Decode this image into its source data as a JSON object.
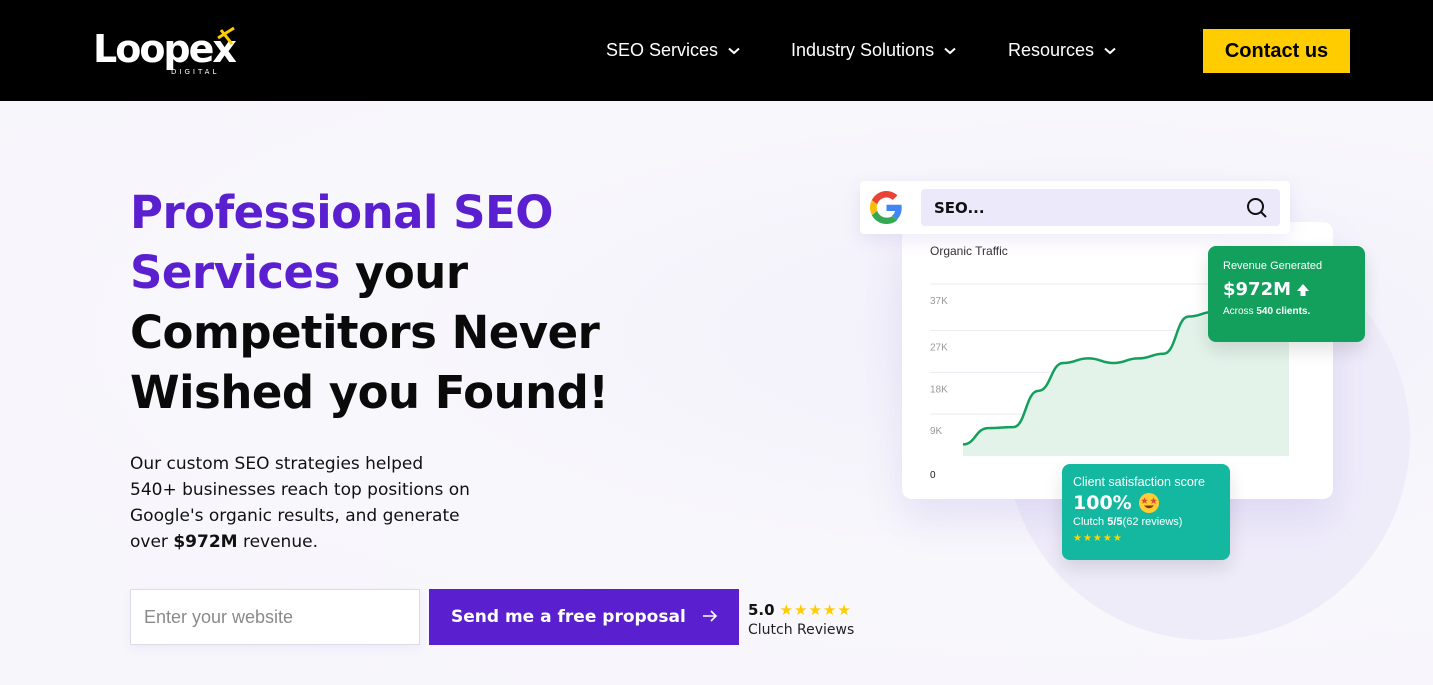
{
  "nav": {
    "logo_text": "Loopex",
    "logo_sub": "DIGITAL",
    "items": [
      {
        "label": "SEO Services"
      },
      {
        "label": "Industry Solutions"
      },
      {
        "label": "Resources"
      }
    ],
    "contact_label": "Contact us"
  },
  "hero": {
    "headline_purple": "Professional SEO Services",
    "headline_black_1": " your",
    "headline_black_2": "Competitors Never Wished you Found!",
    "sub_text": "Our custom SEO strategies helped 540+ businesses reach top positions on Google's organic results, and generate over ",
    "sub_bold": "$972M",
    "sub_end": " revenue.",
    "input_placeholder": "Enter your website",
    "proposal_label": "Send me a free proposal",
    "rating_score": "5.0",
    "rating_stars": "★★★★★",
    "rating_label": "Clutch Reviews"
  },
  "visual": {
    "search_text": "SEO...",
    "chart_title": "Organic Traffic",
    "revenue": {
      "title": "Revenue Generated",
      "value": "$972M",
      "sub_prefix": "Across ",
      "sub_bold": "540 clients."
    },
    "satisfaction": {
      "title": "Client satisfaction score",
      "value": "100%",
      "sub_prefix": "Clutch ",
      "sub_bold": "5/5",
      "sub_suffix": "(62 reviews)",
      "stars": "★★★★★"
    }
  },
  "chart_data": {
    "type": "area",
    "title": "Organic Traffic",
    "y_ticks": [
      "0",
      "9K",
      "18K",
      "27K",
      "37K"
    ],
    "ylim": [
      0,
      37000
    ],
    "x": [
      0,
      1,
      2,
      3,
      4,
      5,
      6,
      7,
      8,
      9,
      10,
      11,
      12,
      13
    ],
    "values": [
      2500,
      6000,
      6200,
      14000,
      20000,
      21000,
      20000,
      21000,
      22000,
      30000,
      31000,
      30000,
      31500,
      32000
    ],
    "color": "#12a05c",
    "fill": "#e3f3ea"
  },
  "colors": {
    "accent": "#5a20d0",
    "cta": "#ffcc00",
    "green": "#12a05c",
    "teal": "#14b8a0"
  }
}
